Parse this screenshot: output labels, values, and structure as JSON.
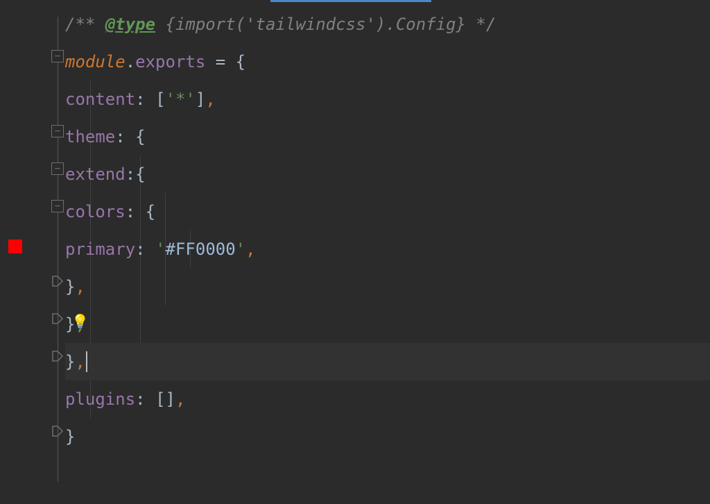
{
  "code": {
    "comment_start": "/** ",
    "doctag": "@type",
    "comment_type": " {import('tailwindcss').Config} */",
    "module_kw": "module",
    "dot": ".",
    "exports": "exports",
    "equals": " = ",
    "open_brace": "{",
    "content_key": "content",
    "colon": ": ",
    "bracket_open": "[",
    "quote": "'",
    "star": "*",
    "bracket_close": "]",
    "comma": ",",
    "theme_key": "theme",
    "extend_key": "extend",
    "colon_nospace": ":",
    "colors_key": "colors",
    "primary_key": "primary",
    "primary_value": "#FF0000",
    "close_brace": "}",
    "plugins_key": "plugins",
    "empty_brackets": "[]"
  },
  "colors": {
    "primary": "#FF0000"
  }
}
